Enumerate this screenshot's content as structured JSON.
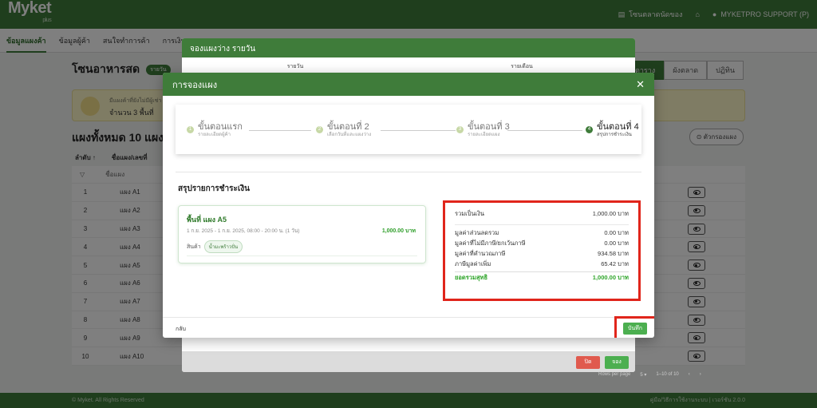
{
  "app": {
    "logo": "Myket",
    "logo_sub": "plus",
    "topbar_store": "โซนตลาดนัดของ",
    "topbar_user": "MYKETPRO SUPPORT (P)"
  },
  "nav": [
    "ข้อมูลแผงค้า",
    "ข้อมูลผู้ค้า",
    "สนใจทำการค้า",
    "การเงิน"
  ],
  "page": {
    "zone_title": "โซนอาหารสด",
    "zone_tag": "รายวัน",
    "view_tabs": [
      "ตาราง",
      "ผังตลาด",
      "ปฏิทิน"
    ],
    "notice_small": "มีแผงค้าที่ยังไม่มีผู้เช่า",
    "notice_main": "จำนวน 3 พื้นที่",
    "total_title": "แผงทั้งหมด 10 แผง",
    "filter_label": "ตัวกรองแผง",
    "col_order": "ลำดับ ↑",
    "col_name": "ชื่อแผง/เลขที่",
    "filter_name": "ชื่อแผง",
    "rows": [
      {
        "no": "1",
        "name": "แผง A1"
      },
      {
        "no": "2",
        "name": "แผง A2"
      },
      {
        "no": "3",
        "name": "แผง A3"
      },
      {
        "no": "4",
        "name": "แผง A4"
      },
      {
        "no": "5",
        "name": "แผง A5"
      },
      {
        "no": "6",
        "name": "แผง A6"
      },
      {
        "no": "7",
        "name": "แผง A7"
      },
      {
        "no": "8",
        "name": "แผง A8"
      },
      {
        "no": "9",
        "name": "แผง A9"
      },
      {
        "no": "10",
        "name": "แผง A10"
      }
    ],
    "rows_per_page_label": "Rows per page",
    "rows_per_page": "5",
    "page_range": "1–10 of 10",
    "footer_left": "© Myket. All Rights Reserved",
    "footer_right": "คู่มือ/วิธีการใช้งานระบบ | เวอร์ชัน 2.0.0"
  },
  "mid_modal": {
    "title": "จองแผงว่าง รายวัน",
    "tabs": [
      "รายวัน",
      "รายเดือน"
    ],
    "cancel": "ปิด",
    "book": "จอง"
  },
  "modal": {
    "title": "การจองแผง",
    "steps": [
      {
        "label": "ขั้นตอนแรก",
        "sub": "รายละเอียดผู้ค้า",
        "num": "1"
      },
      {
        "label": "ขั้นตอนที่ 2",
        "sub": "เลือกวันที่และแผงว่าง",
        "num": "2"
      },
      {
        "label": "ขั้นตอนที่ 3",
        "sub": "รายละเอียดแผง",
        "num": "3"
      },
      {
        "label": "ขั้นตอนที่ 4",
        "sub": "สรุปการชำระเงิน",
        "num": "4"
      }
    ],
    "section_title": "สรุปรายการชำระเงิน",
    "item": {
      "name": "พื้นที่ แผง A5",
      "time": "1 ก.ย. 2025 - 1 ก.ย. 2025, 08:00 - 20:00 น. (1 วัน)",
      "price": "1,000.00 บาท",
      "product_label": "สินค้า",
      "product": "น้ำมะพร้าวปั่น"
    },
    "summary": [
      {
        "label": "รวมเป็นเงิน",
        "value": "1,000.00 บาท"
      },
      {
        "label": "มูลค่าส่วนลดรวม",
        "value": "0.00 บาท"
      },
      {
        "label": "มูลค่าที่ไม่มีภาษี/ยกเว้นภาษี",
        "value": "0.00 บาท"
      },
      {
        "label": "มูลค่าที่คำนวณภาษี",
        "value": "934.58 บาท"
      },
      {
        "label": "ภาษีมูลค่าเพิ่ม",
        "value": "65.42 บาท"
      }
    ],
    "total_label": "ยอดรวมสุทธิ",
    "total_value": "1,000.00 บาท",
    "back": "กลับ",
    "save": "บันทึก"
  },
  "colors": {
    "primary": "#3f7c3a",
    "highlight": "#e0251b",
    "accent_green": "#2fa52a"
  }
}
